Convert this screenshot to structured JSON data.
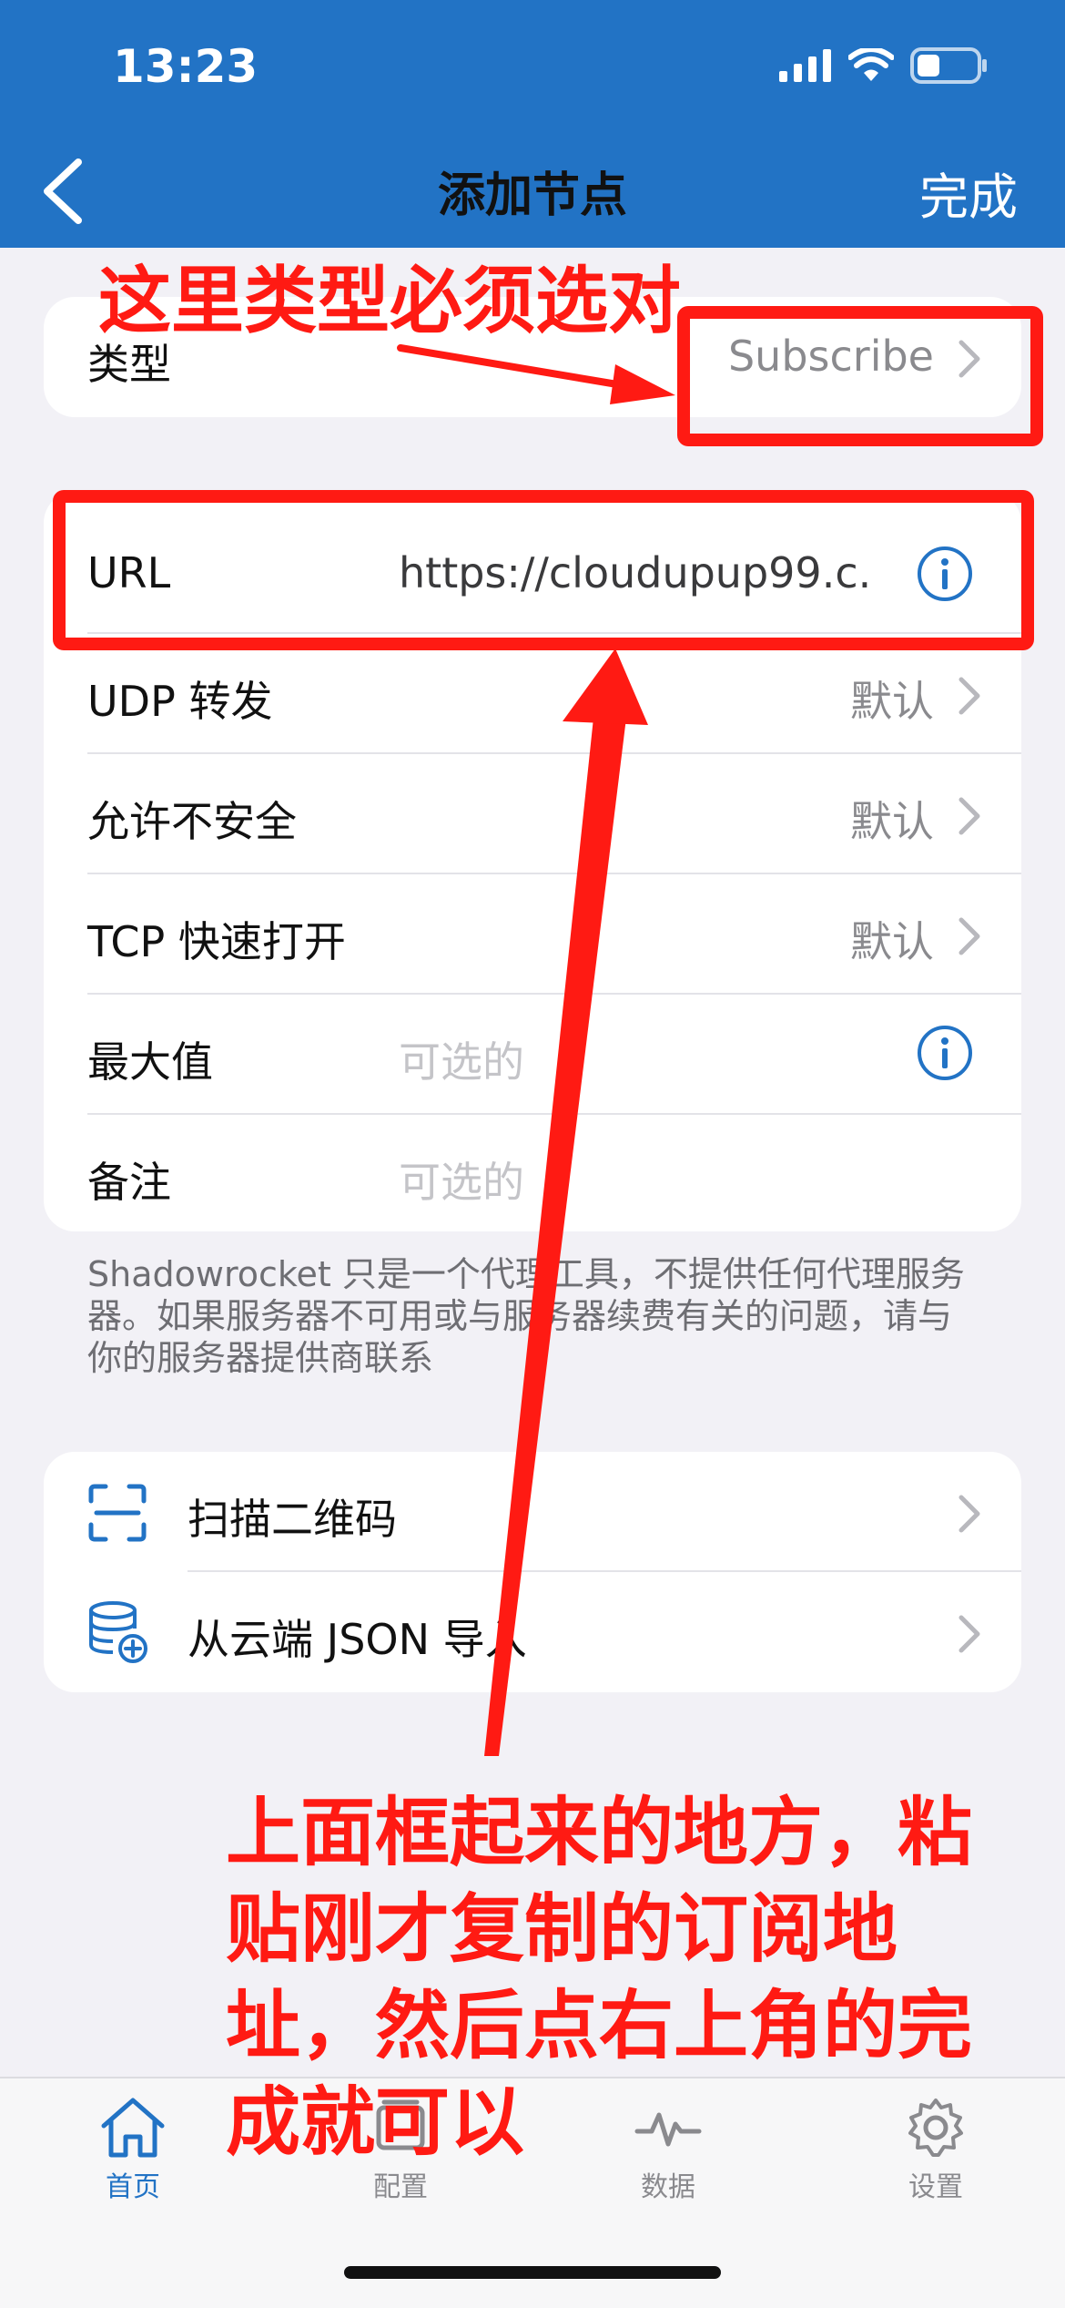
{
  "status_bar": {
    "time": "13:23"
  },
  "nav": {
    "title": "添加节点",
    "done_label": "完成"
  },
  "type_row": {
    "label": "类型",
    "value": "Subscribe"
  },
  "rows": [
    {
      "label": "URL",
      "value": "https://cloudupup99.c..."
    },
    {
      "label": "UDP 转发",
      "value": "默认"
    },
    {
      "label": "允许不安全",
      "value": "默认"
    },
    {
      "label": "TCP 快速打开",
      "value": "默认"
    },
    {
      "label": "最大值",
      "placeholder": "可选的"
    },
    {
      "label": "备注",
      "placeholder": "可选的"
    }
  ],
  "footer_note": "Shadowrocket 只是一个代理工具，不提供任何代理服务器。如果服务器不可用或与服务器续费有关的问题，请与你的服务器提供商联系",
  "actions": [
    {
      "label": "扫描二维码",
      "icon": "qr-scan-icon"
    },
    {
      "label": "从云端 JSON 导入",
      "icon": "cloud-database-icon"
    }
  ],
  "annotations": {
    "top": "这里类型必须选对",
    "bottom": "上面框起来的地方，粘贴刚才复制的订阅地址，然后点右上角的完成就可以"
  },
  "tabs": [
    {
      "label": "首页",
      "icon": "home-icon",
      "active": true
    },
    {
      "label": "配置",
      "icon": "config-icon",
      "active": false
    },
    {
      "label": "数据",
      "icon": "pulse-icon",
      "active": false
    },
    {
      "label": "设置",
      "icon": "gear-icon",
      "active": false
    }
  ],
  "colors": {
    "header": "#2273c5",
    "accent": "#2273c5",
    "annotation": "#ff1a13"
  }
}
